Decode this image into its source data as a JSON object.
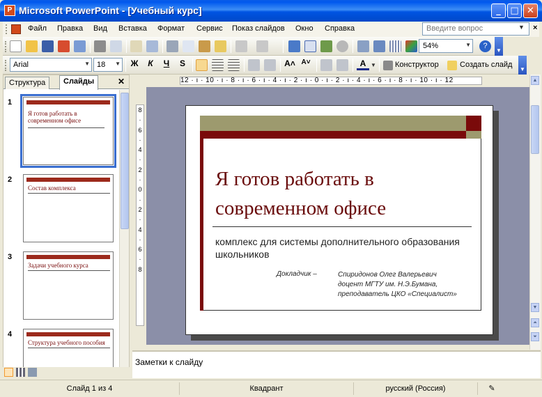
{
  "window": {
    "title": "Microsoft PowerPoint - [Учебный курс]",
    "icon": "powerpoint-icon"
  },
  "menu": {
    "items": [
      "Файл",
      "Правка",
      "Вид",
      "Вставка",
      "Формат",
      "Сервис",
      "Показ слайдов",
      "Окно",
      "Справка"
    ],
    "help_placeholder": "Введите вопрос"
  },
  "toolbar_standard": {
    "zoom": "54%"
  },
  "toolbar_format": {
    "font": "Arial",
    "size": "18",
    "bold": "Ж",
    "italic": "К",
    "underline": "Ч",
    "shadow": "S",
    "designer": "Конструктор",
    "new_slide": "Создать слайд"
  },
  "left_pane": {
    "tabs": [
      "Структура",
      "Слайды"
    ],
    "active_tab": "Слайды",
    "slides": [
      {
        "num": "1",
        "title": "Я готов работать в современном офисе"
      },
      {
        "num": "2",
        "title": "Состав комплекса"
      },
      {
        "num": "3",
        "title": "Задачи учебного курса"
      },
      {
        "num": "4",
        "title": "Структура учебного пособия"
      }
    ]
  },
  "ruler_h": "12 · ı · 10 · ı · 8 · ı · 6 · ı · 4 · ı · 2 · ı · 0 · ı · 2 · ı · 4 · ı · 6 · ı · 8 · ı · 10 · ı · 12",
  "ruler_v": [
    "8",
    "·",
    "6",
    "·",
    "4",
    "·",
    "2",
    "·",
    "0",
    "·",
    "2",
    "·",
    "4",
    "·",
    "6",
    "·",
    "8"
  ],
  "slide": {
    "title": "Я готов работать в современном офисе",
    "subtitle": "комплекс для системы дополнительного образования школьников",
    "reporter_label": "Докладчик –",
    "reporter_lines": [
      "Спиридонов Олег Валерьевич",
      "доцент МГТУ им. Н.Э.Бумана,",
      "преподаватель ЦКО «Специалист»"
    ]
  },
  "notes_placeholder": "Заметки к слайду",
  "status": {
    "slide": "Слайд 1 из 4",
    "design": "Квадрант",
    "language": "русский (Россия)"
  },
  "colors": {
    "title_blue": "#0054e3",
    "slide_red": "#7a0a0a",
    "slide_tan": "#9d9a6e",
    "title_text": "#6a0d0d"
  }
}
